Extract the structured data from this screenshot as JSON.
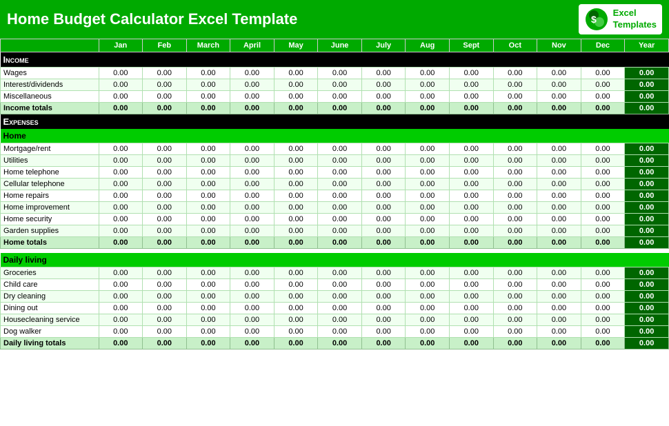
{
  "header": {
    "title": "Home Budget Calculator Excel Template",
    "logo_line1": "Excel",
    "logo_line2": "Templates"
  },
  "months": [
    "Jan",
    "Feb",
    "March",
    "April",
    "May",
    "June",
    "July",
    "Aug",
    "Sept",
    "Oct",
    "Nov",
    "Dec",
    "Year"
  ],
  "sections": {
    "income": {
      "label": "Income",
      "rows": [
        {
          "label": "Wages"
        },
        {
          "label": "Interest/dividends"
        },
        {
          "label": "Miscellaneous"
        }
      ],
      "totals_label": "Income totals"
    },
    "expenses": {
      "label": "Expenses"
    },
    "home": {
      "label": "Home",
      "rows": [
        {
          "label": "Mortgage/rent"
        },
        {
          "label": "Utilities"
        },
        {
          "label": "Home telephone"
        },
        {
          "label": "Cellular telephone"
        },
        {
          "label": "Home repairs"
        },
        {
          "label": "Home improvement"
        },
        {
          "label": "Home security"
        },
        {
          "label": "Garden supplies"
        }
      ],
      "totals_label": "Home totals"
    },
    "daily_living": {
      "label": "Daily living",
      "rows": [
        {
          "label": "Groceries"
        },
        {
          "label": "Child care"
        },
        {
          "label": "Dry cleaning"
        },
        {
          "label": "Dining out"
        },
        {
          "label": "Housecleaning service"
        },
        {
          "label": "Dog walker"
        }
      ],
      "totals_label": "Daily living totals"
    }
  },
  "zero": "0.00",
  "bold_zero": "0.00"
}
